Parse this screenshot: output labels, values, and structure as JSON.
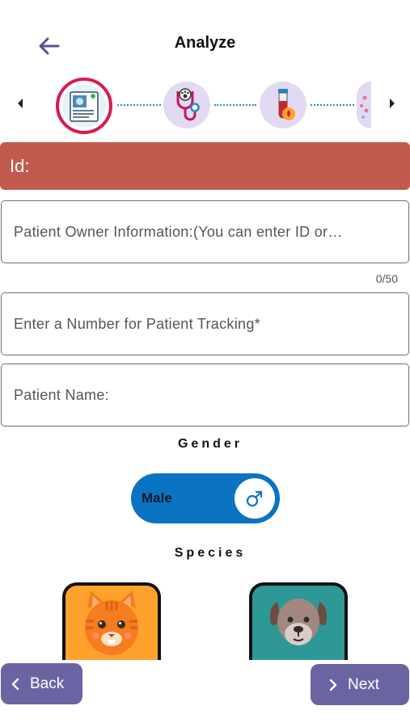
{
  "header": {
    "title": "Analyze"
  },
  "stepper": {
    "steps": [
      {
        "name": "patient-record-icon",
        "active": true
      },
      {
        "name": "stethoscope-icon",
        "active": false
      },
      {
        "name": "blood-tube-icon",
        "active": false
      },
      {
        "name": "cells-icon",
        "active": false
      }
    ],
    "active_color": "#d81b4f",
    "inactive_bg": "#e3d9f3"
  },
  "id_banner": {
    "label": "Id:",
    "color": "#c25b4d"
  },
  "form": {
    "owner_placeholder": "Patient Owner Information:(You can enter ID or…",
    "owner_counter": "0/50",
    "tracking_placeholder": "Enter a Number for Patient Tracking*",
    "name_placeholder": "Patient Name:"
  },
  "gender": {
    "label": "Gender",
    "value": "Male",
    "icon": "male-symbol-icon",
    "color": "#0a74c2"
  },
  "species": {
    "label": "Species",
    "options": [
      {
        "name": "cat",
        "color": "#ffa22d"
      },
      {
        "name": "dog",
        "color": "#2d9896"
      }
    ]
  },
  "footer": {
    "back_label": "Back",
    "next_label": "Next",
    "button_color": "#6b64a3"
  }
}
